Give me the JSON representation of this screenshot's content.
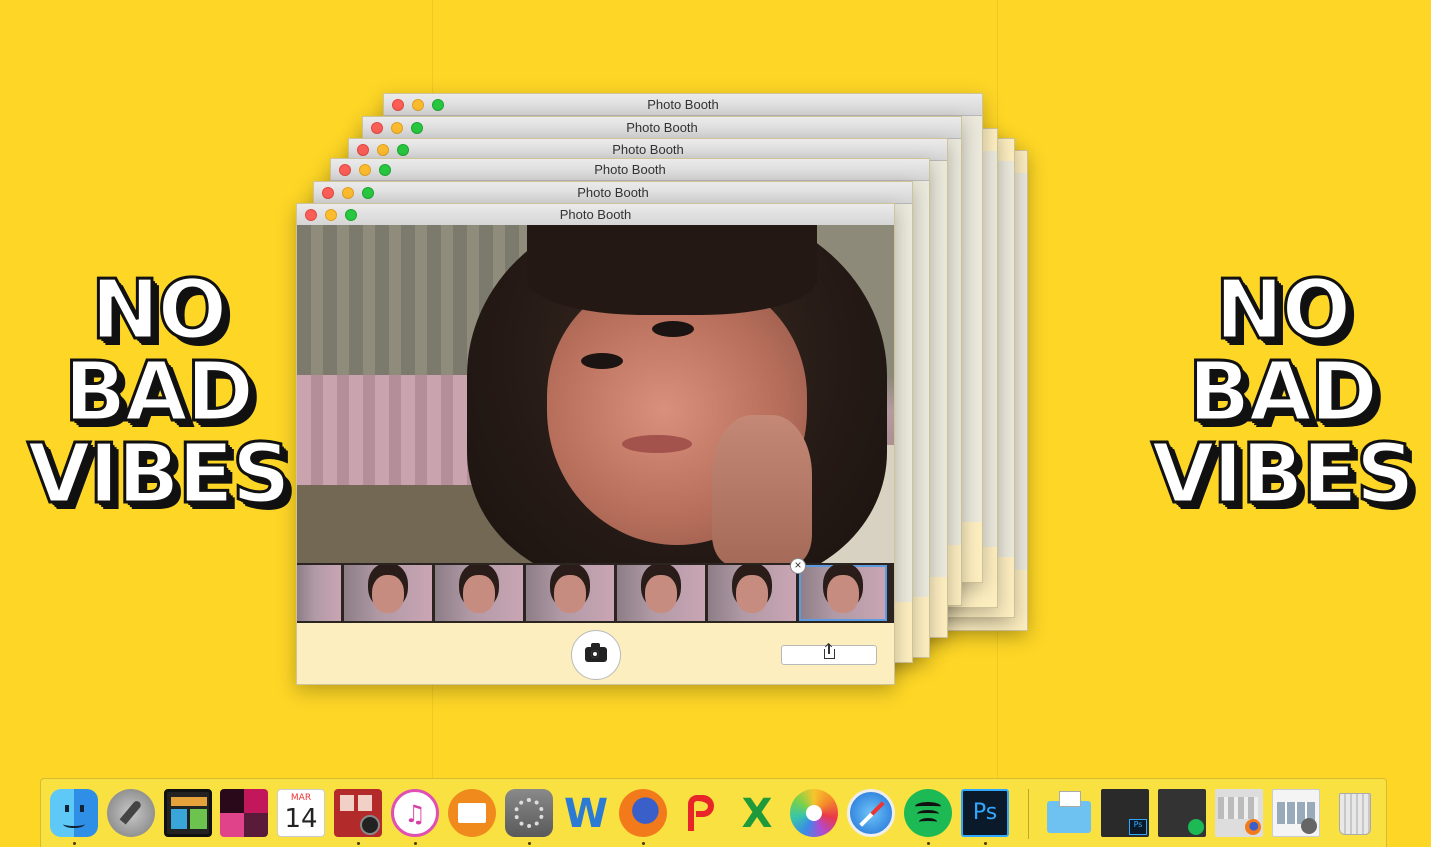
{
  "window": {
    "title": "Photo Booth"
  },
  "slogan": {
    "line1": "NO",
    "line2": "BAD",
    "line3": "VIBES"
  },
  "photobooth": {
    "thumbnails_count": 7,
    "selected_thumbnail": 7,
    "remove_symbol": "×"
  },
  "dock": {
    "calendar_month": "MAR",
    "calendar_day": "14",
    "word_letter": "W",
    "excel_letter": "X",
    "photoshop_letters": "Ps",
    "apps": [
      "finder-icon",
      "launchpad-icon",
      "photo-slideshow-icon",
      "pixel-app-icon",
      "calendar-icon",
      "photo-booth-icon",
      "itunes-icon",
      "ibooks-icon",
      "system-preferences-icon",
      "word-icon",
      "firefox-icon",
      "polarr-icon",
      "excel-icon",
      "photos-icon",
      "safari-icon",
      "spotify-icon",
      "photoshop-icon"
    ],
    "stack_items": [
      "downloads-folder-icon",
      "photoshop-window-thumb",
      "spotify-window-thumb",
      "firefox-window-thumb",
      "photobooth-window-thumb",
      "trash-icon"
    ]
  }
}
